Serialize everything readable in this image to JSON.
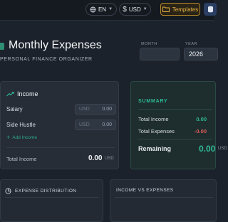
{
  "toolbar": {
    "language": "EN",
    "currency": "USD",
    "templates_label": "Templates"
  },
  "header": {
    "title": "Monthly Expenses",
    "subtitle": "PERSONAL FINANCE ORGANIZER",
    "month_label": "MONTH",
    "month_value": "",
    "year_label": "YEAR",
    "year_value": "2026"
  },
  "income": {
    "title": "Income",
    "rows": [
      {
        "label": "Salary",
        "currency": "USD",
        "value": "0.00"
      },
      {
        "label": "Side Hustle",
        "currency": "USD",
        "value": "0.00"
      }
    ],
    "add_label": "Add Income",
    "total_label": "Total Income",
    "total_value": "0.00",
    "total_currency": "USD"
  },
  "summary": {
    "title": "SUMMARY",
    "total_income_label": "Total Income",
    "total_income_value": "0.00",
    "total_expenses_label": "Total Expenses",
    "total_expenses_value": "-0.00",
    "remaining_label": "Remaining",
    "remaining_value": "0.00",
    "remaining_currency": "USD"
  },
  "panels": {
    "expense_distribution": "EXPENSE DISTRIBUTION",
    "income_vs_expenses": "INCOME VS EXPENSES"
  },
  "colors": {
    "accent_green": "#2fb996",
    "accent_gold": "#e8b445",
    "negative_red": "#e05a5a"
  }
}
